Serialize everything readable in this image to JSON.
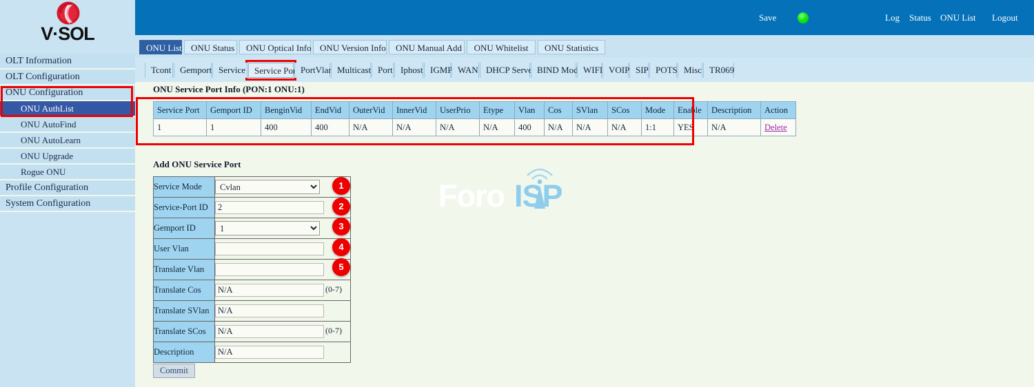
{
  "brand": {
    "logo_text": "V·SOL",
    "logo_icon": "vsol-red-circle-logo"
  },
  "header": {
    "save_label": "Save",
    "status_led": "green-status-indicator",
    "led_color": "#13e913",
    "bar_color": "#0571b8",
    "links": {
      "log": "Log",
      "status": "Status",
      "onu_list": "ONU List",
      "logout": "Logout"
    }
  },
  "sidebar": {
    "items": [
      {
        "label": "OLT Information",
        "sub": false,
        "active": false
      },
      {
        "label": "OLT Configuration",
        "sub": false,
        "active": false
      },
      {
        "label": "ONU Configuration",
        "sub": false,
        "active": false
      },
      {
        "label": "ONU AuthList",
        "sub": true,
        "active": true
      },
      {
        "label": "ONU AutoFind",
        "sub": true,
        "active": false
      },
      {
        "label": "ONU AutoLearn",
        "sub": true,
        "active": false
      },
      {
        "label": "ONU Upgrade",
        "sub": true,
        "active": false
      },
      {
        "label": "Rogue ONU",
        "sub": true,
        "active": false
      },
      {
        "label": "Profile Configuration",
        "sub": false,
        "active": false
      },
      {
        "label": "System Configuration",
        "sub": false,
        "active": false
      }
    ]
  },
  "tabs_primary": [
    {
      "label": "ONU List",
      "active": true
    },
    {
      "label": "ONU Status",
      "active": false
    },
    {
      "label": "ONU Optical Info",
      "active": false
    },
    {
      "label": "ONU Version Info",
      "active": false
    },
    {
      "label": "ONU Manual Add",
      "active": false
    },
    {
      "label": "ONU Whitelist",
      "active": false
    },
    {
      "label": "ONU Statistics",
      "active": false
    }
  ],
  "tabs_secondary": [
    {
      "label": "Tcont",
      "selected": false
    },
    {
      "label": "Gemport",
      "selected": false
    },
    {
      "label": "Service",
      "selected": false
    },
    {
      "label": "Service Port",
      "selected": true
    },
    {
      "label": "PortVlan",
      "selected": false
    },
    {
      "label": "Multicast",
      "selected": false
    },
    {
      "label": "Port",
      "selected": false
    },
    {
      "label": "Iphost",
      "selected": false
    },
    {
      "label": "IGMP",
      "selected": false
    },
    {
      "label": "WAN",
      "selected": false
    },
    {
      "label": "DHCP Server",
      "selected": false
    },
    {
      "label": "BIND Mode",
      "selected": false
    },
    {
      "label": "WIFI",
      "selected": false
    },
    {
      "label": "VOIP",
      "selected": false
    },
    {
      "label": "SIP",
      "selected": false
    },
    {
      "label": "POTS",
      "selected": false
    },
    {
      "label": "Misc",
      "selected": false
    },
    {
      "label": "TR069",
      "selected": false
    }
  ],
  "info_section": {
    "title": "ONU Service Port Info (PON:1 ONU:1)",
    "columns": [
      "Service Port",
      "Gemport ID",
      "BenginVid",
      "EndVid",
      "OuterVid",
      "InnerVid",
      "UserPrio",
      "Etype",
      "Vlan",
      "Cos",
      "SVlan",
      "SCos",
      "Mode",
      "Enable",
      "Description",
      "Action"
    ],
    "rows": [
      {
        "service_port": "1",
        "gemport_id": "1",
        "bengin_vid": "400",
        "end_vid": "400",
        "outer_vid": "N/A",
        "inner_vid": "N/A",
        "user_prio": "N/A",
        "etype": "N/A",
        "vlan": "400",
        "cos": "N/A",
        "svlan": "N/A",
        "scos": "N/A",
        "mode": "1:1",
        "enable": "YES",
        "description": "N/A",
        "action": "Delete"
      }
    ]
  },
  "add_section": {
    "title": "Add ONU Service Port",
    "fields": [
      {
        "label": "Service Mode",
        "value": "Cvlan",
        "type": "select",
        "hint": "",
        "badge": "1"
      },
      {
        "label": "Service-Port ID",
        "value": "2",
        "type": "text",
        "hint": "",
        "badge": "2"
      },
      {
        "label": "Gemport ID",
        "value": "1",
        "type": "select",
        "hint": "",
        "badge": "3"
      },
      {
        "label": "User Vlan",
        "value": "",
        "type": "text",
        "hint": "",
        "badge": "4"
      },
      {
        "label": "Translate Vlan",
        "value": "",
        "type": "text",
        "hint": "",
        "badge": "5"
      },
      {
        "label": "Translate Cos",
        "value": "N/A",
        "type": "text",
        "hint": "(0-7)",
        "badge": ""
      },
      {
        "label": "Translate SVlan",
        "value": "N/A",
        "type": "text",
        "hint": "",
        "badge": ""
      },
      {
        "label": "Translate SCos",
        "value": "N/A",
        "type": "text",
        "hint": "(0-7)",
        "badge": ""
      },
      {
        "label": "Description",
        "value": "N/A",
        "type": "text",
        "hint": "",
        "badge": ""
      }
    ],
    "commit_label": "Commit"
  },
  "annotations": {
    "highlight_color": "#ef0000",
    "badges": [
      "1",
      "2",
      "3",
      "4",
      "5"
    ]
  },
  "watermark": {
    "text_left": "Foro",
    "text_right": "ISP",
    "icon": "antenna-tower-icon"
  }
}
